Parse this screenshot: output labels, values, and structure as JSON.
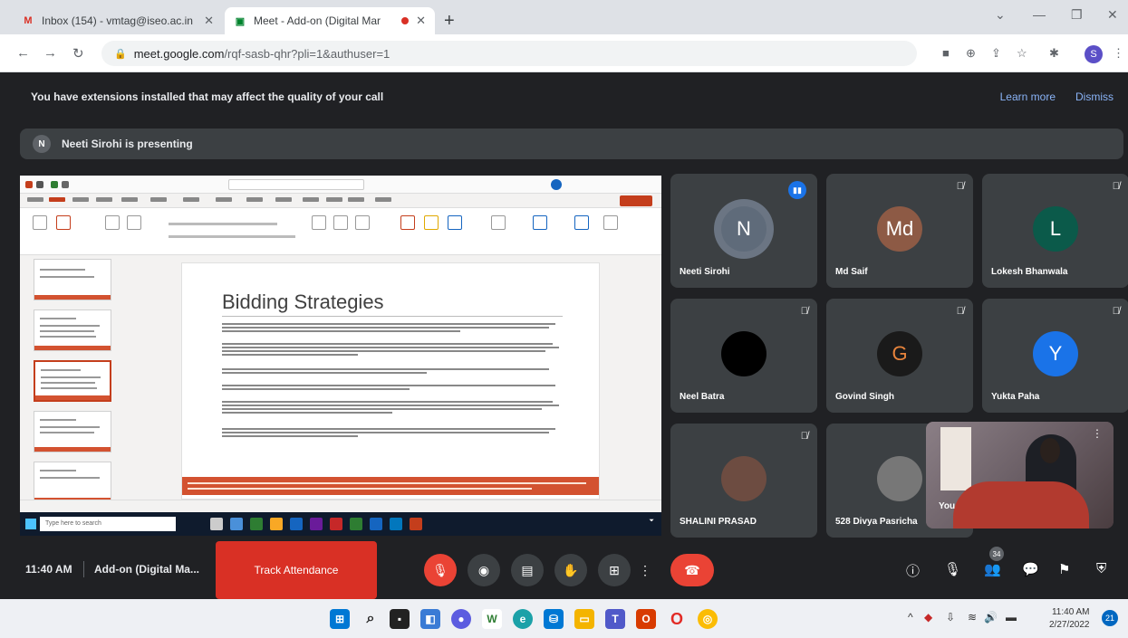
{
  "browser": {
    "tabs": [
      {
        "title": "Inbox (154) - vmtag@iseo.ac.in",
        "favicon": "gmail-icon"
      },
      {
        "title": "Meet - Add-on (Digital Mar",
        "favicon": "meet-icon"
      }
    ],
    "url_host": "meet.google.com",
    "url_path": "/rqf-sasb-qhr?pli=1&authuser=1",
    "profile_initial": "S"
  },
  "banner": {
    "message": "You have extensions installed that may affect the quality of your call",
    "learn_more": "Learn more",
    "dismiss": "Dismiss"
  },
  "presenting": {
    "avatar": "N",
    "text": "Neeti Sirohi is presenting"
  },
  "slide": {
    "title": "Bidding Strategies"
  },
  "taskbar_inner": {
    "search": "Type here to search"
  },
  "participants": [
    {
      "name": "Neeti Sirohi",
      "initial": "N",
      "color": "#5f6b7a",
      "speaking": true
    },
    {
      "name": "Md Saif",
      "initial": "Md",
      "color": "#8d5a45",
      "speaking": false
    },
    {
      "name": "Lokesh Bhanwala",
      "initial": "L",
      "color": "#0b5a4a",
      "speaking": false
    },
    {
      "name": "Neel Batra",
      "initial": "",
      "color": "#000000",
      "speaking": false
    },
    {
      "name": "Govind Singh",
      "initial": "G",
      "color": "#1a1a1a",
      "speaking": false
    },
    {
      "name": "Yukta Paha",
      "initial": "Y",
      "color": "#1a73e8",
      "speaking": false
    },
    {
      "name": "SHALINI PRASAD",
      "initial": "",
      "color": "#6d4c41",
      "speaking": false
    },
    {
      "name": "528 Divya Pasricha",
      "initial": "",
      "color": "#777777",
      "speaking": false
    }
  ],
  "self_label": "You",
  "controls": {
    "time": "11:40 AM",
    "meeting_title": "Add-on (Digital Ma...",
    "track_attendance": "Track Attendance",
    "participant_count": "34"
  },
  "system": {
    "time": "11:40 AM",
    "date": "2/27/2022",
    "notifications": "21"
  }
}
